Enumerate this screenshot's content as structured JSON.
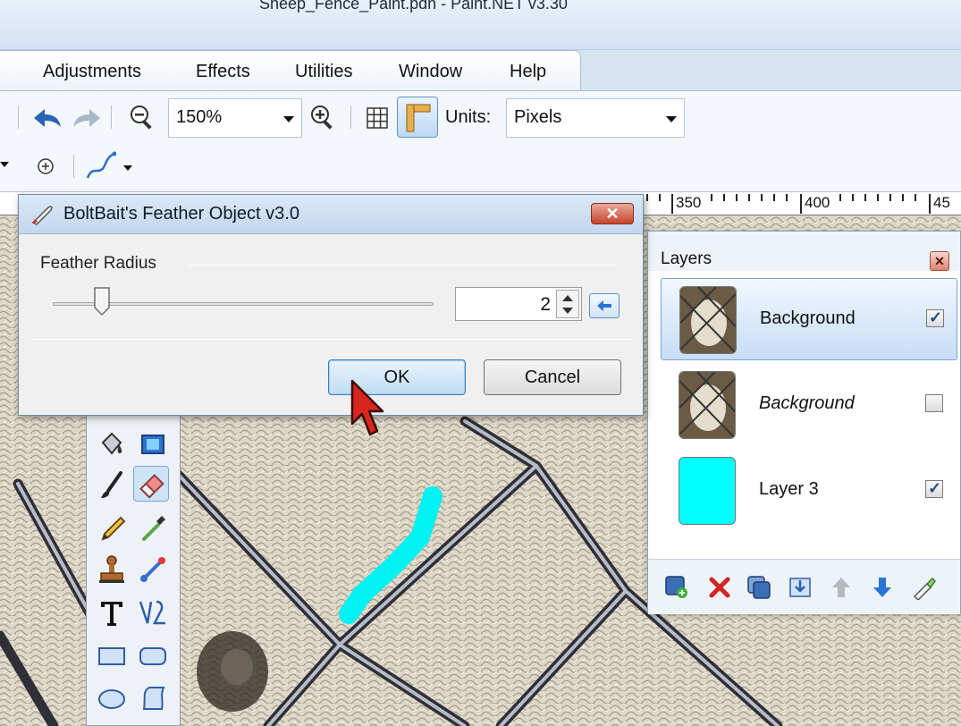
{
  "window": {
    "title": "Sheep_Fence_Paint.pdn - Paint.NET v3.30"
  },
  "menu": {
    "items": [
      "Adjustments",
      "Effects",
      "Utilities",
      "Window",
      "Help"
    ]
  },
  "toolbar": {
    "zoom_value": "150%",
    "units_label": "Units:",
    "units_value": "Pixels"
  },
  "ruler": {
    "labels": [
      "350",
      "400",
      "45"
    ]
  },
  "dialog": {
    "title": "BoltBait's Feather Object v3.0",
    "group_label": "Feather Radius",
    "radius_value": "2",
    "slider_position": 0.13,
    "ok_label": "OK",
    "cancel_label": "Cancel"
  },
  "layers": {
    "title": "Layers",
    "rows": [
      {
        "name": "Background",
        "visible": true,
        "selected": true
      },
      {
        "name": "Background",
        "visible": false,
        "selected": false
      },
      {
        "name": "Layer 3",
        "visible": true,
        "selected": false
      }
    ]
  },
  "colors": {
    "accent": "#3d7bbf",
    "layer3_fill": "#00ffff",
    "close_red": "#c6452b"
  }
}
